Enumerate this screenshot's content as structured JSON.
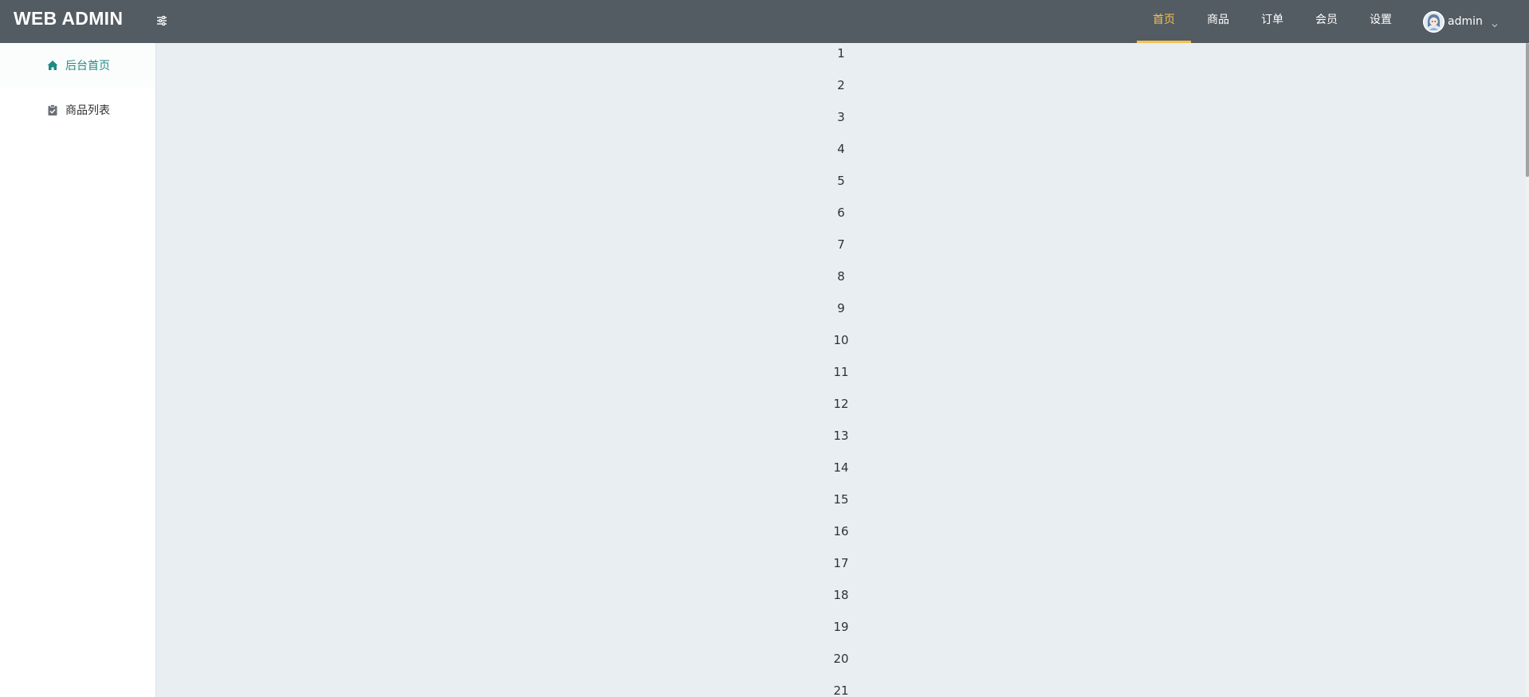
{
  "header": {
    "brand": "WEB ADMIN",
    "toggle_icon": "sliders-icon",
    "nav": [
      {
        "label": "首页",
        "active": true
      },
      {
        "label": "商品",
        "active": false
      },
      {
        "label": "订单",
        "active": false
      },
      {
        "label": "会员",
        "active": false
      },
      {
        "label": "设置",
        "active": false
      }
    ],
    "user": {
      "name": "admin",
      "avatar_icon": "avatar-icon",
      "caret_icon": "chevron-down-icon"
    }
  },
  "sidebar": {
    "items": [
      {
        "label": "后台首页",
        "icon": "home-icon",
        "active": true
      },
      {
        "label": "商品列表",
        "icon": "clipboard-check-icon",
        "active": false
      }
    ]
  },
  "main": {
    "numbers": [
      "1",
      "2",
      "3",
      "4",
      "5",
      "6",
      "7",
      "8",
      "9",
      "10",
      "11",
      "12",
      "13",
      "14",
      "15",
      "16",
      "17",
      "18",
      "19",
      "20",
      "21"
    ]
  },
  "colors": {
    "header_bg": "#535b63",
    "accent": "#f3c34f",
    "sidebar_active": "#1f8a82",
    "content_bg": "#e9eef2"
  }
}
